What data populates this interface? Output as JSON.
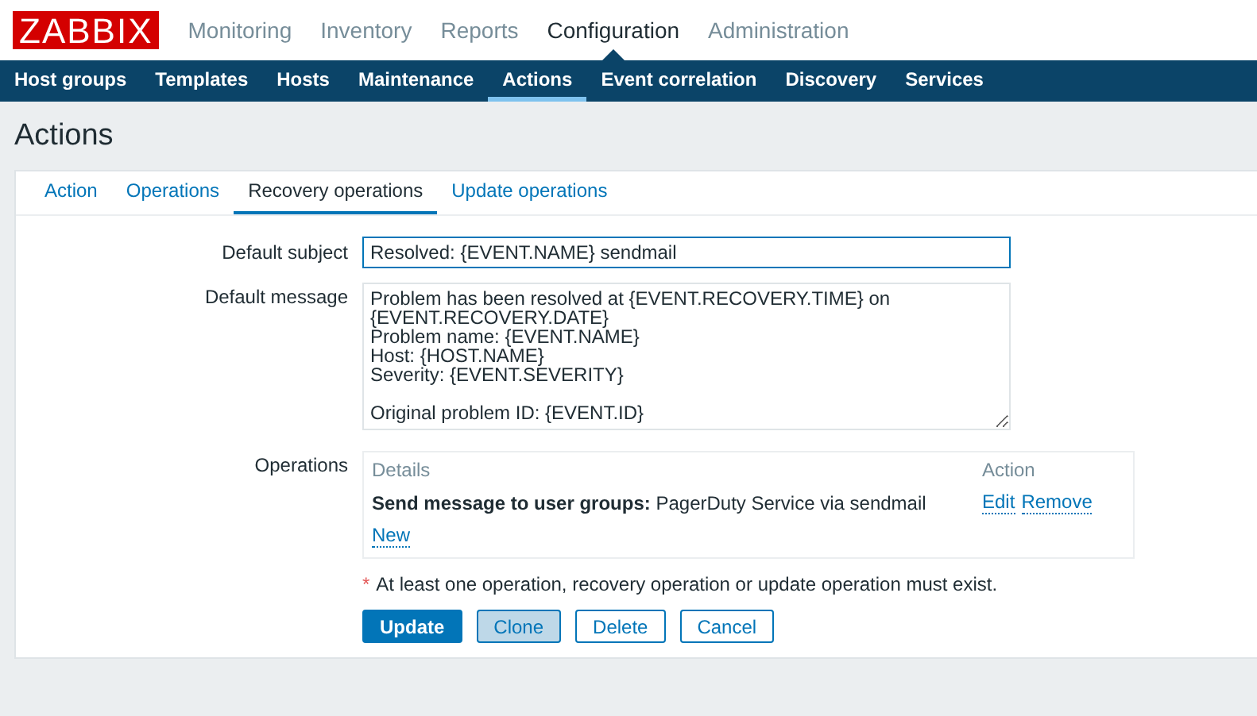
{
  "logo": "ZABBIX",
  "main_menu": [
    {
      "label": "Monitoring",
      "selected": false
    },
    {
      "label": "Inventory",
      "selected": false
    },
    {
      "label": "Reports",
      "selected": false
    },
    {
      "label": "Configuration",
      "selected": true
    },
    {
      "label": "Administration",
      "selected": false
    }
  ],
  "sub_menu": [
    {
      "label": "Host groups",
      "selected": false
    },
    {
      "label": "Templates",
      "selected": false
    },
    {
      "label": "Hosts",
      "selected": false
    },
    {
      "label": "Maintenance",
      "selected": false
    },
    {
      "label": "Actions",
      "selected": true
    },
    {
      "label": "Event correlation",
      "selected": false
    },
    {
      "label": "Discovery",
      "selected": false
    },
    {
      "label": "Services",
      "selected": false
    }
  ],
  "page_title": "Actions",
  "tabs": [
    {
      "label": "Action",
      "selected": false
    },
    {
      "label": "Operations",
      "selected": false
    },
    {
      "label": "Recovery operations",
      "selected": true
    },
    {
      "label": "Update operations",
      "selected": false
    }
  ],
  "form": {
    "default_subject": {
      "label": "Default subject",
      "value": "Resolved: {EVENT.NAME} sendmail"
    },
    "default_message": {
      "label": "Default message",
      "value": "Problem has been resolved at {EVENT.RECOVERY.TIME} on\n{EVENT.RECOVERY.DATE}\nProblem name: {EVENT.NAME}\nHost: {HOST.NAME}\nSeverity: {EVENT.SEVERITY}\n\nOriginal problem ID: {EVENT.ID}"
    },
    "operations": {
      "label": "Operations",
      "columns": [
        "Details",
        "Action"
      ],
      "rows": [
        {
          "details": "**Send message to user groups:** PagerDuty Service via sendmail",
          "actions": [
            "Edit",
            "Remove"
          ]
        }
      ],
      "new_link": "New"
    },
    "required_mark": "*",
    "note": "At least one operation, recovery operation or update operation must exist."
  },
  "buttons": [
    {
      "label": "Update",
      "kind": "primary",
      "highlighted": false
    },
    {
      "label": "Clone",
      "kind": "secondary",
      "highlighted": true
    },
    {
      "label": "Delete",
      "kind": "secondary",
      "highlighted": false
    },
    {
      "label": "Cancel",
      "kind": "secondary",
      "highlighted": false
    }
  ]
}
